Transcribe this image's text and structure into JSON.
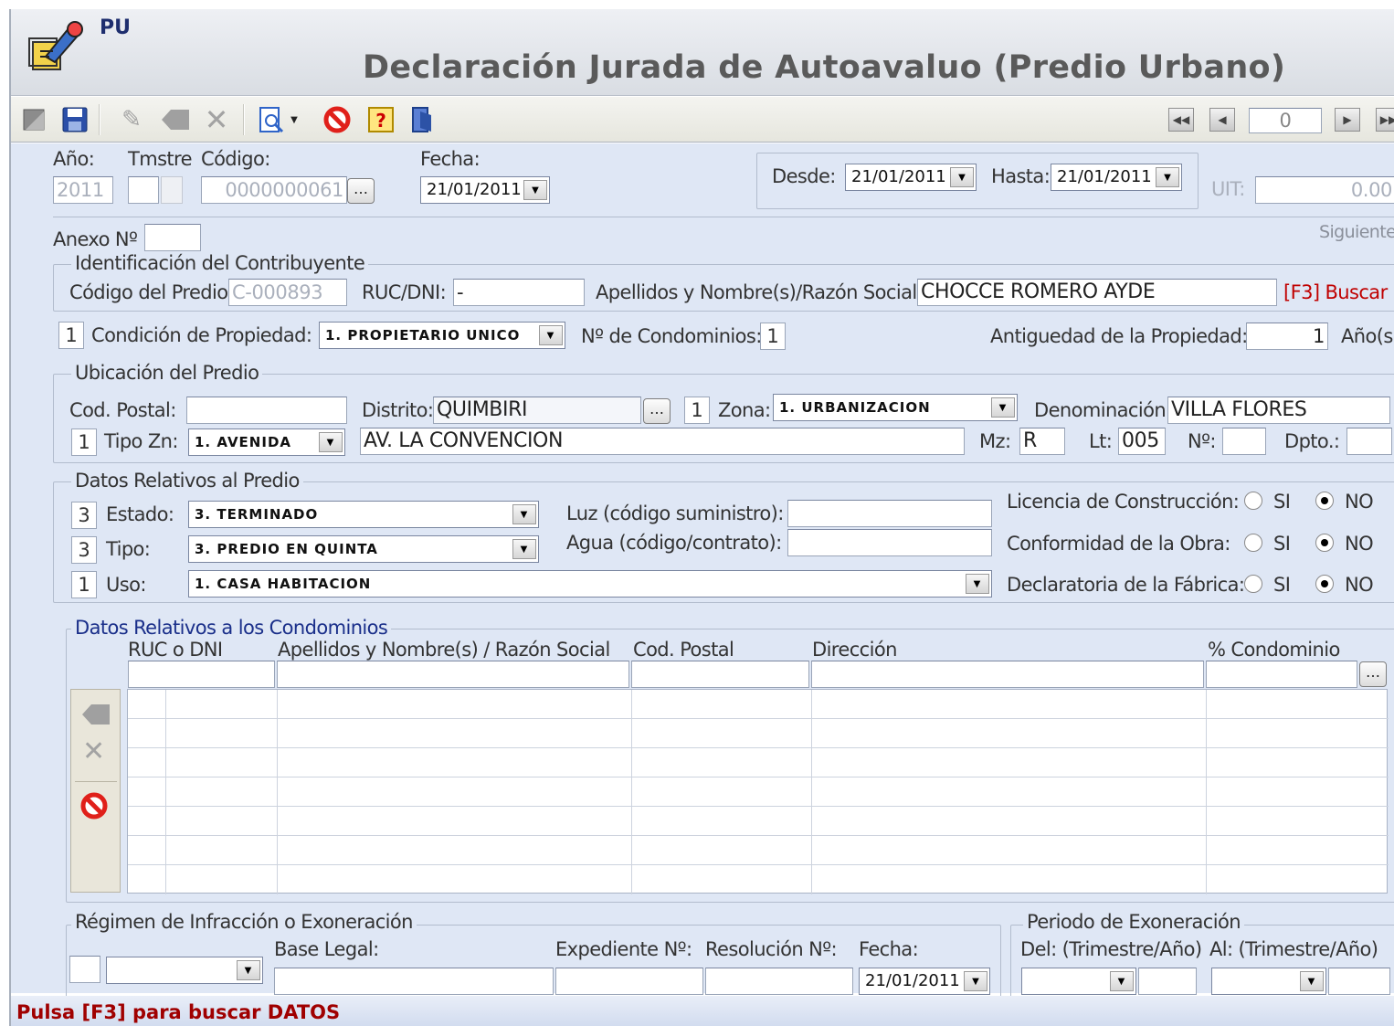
{
  "app": {
    "badge": "PU",
    "title": "Declaración Jurada de Autoavaluo (Predio Urbano)"
  },
  "toolbar": {
    "record_counter": "0"
  },
  "header": {
    "anio_label": "Año:",
    "anio_value": "2011",
    "tmstre_label": "Tmstre",
    "codigo_label": "Código:",
    "codigo_value": "0000000061",
    "fecha_label": "Fecha:",
    "fecha_value": "21/01/2011",
    "desde_label": "Desde:",
    "desde_value": "21/01/2011",
    "hasta_label": "Hasta:",
    "hasta_value": "21/01/2011",
    "uit_label": "UIT:",
    "uit_value": "0.00",
    "anexo_label": "Anexo Nº",
    "siguiente": "Siguiente"
  },
  "contribuyente": {
    "title": "Identificación del Contribuyente",
    "codigo_predio_label": "Código del Predio:",
    "codigo_predio_value": "C-000893",
    "ruc_label": "RUC/DNI:",
    "ruc_value": "-",
    "nombre_label": "Apellidos y Nombre(s)/Razón Social:",
    "nombre_value": "CHOCCE ROMERO AYDE",
    "buscar": "[F3] Buscar"
  },
  "propiedad": {
    "cond_num": "1",
    "cond_label": "Condición de Propiedad:",
    "cond_value": "1. PROPIETARIO UNICO",
    "condominios_label": "Nº de Condominios:",
    "condominios_value": "1",
    "antiguedad_label": "Antiguedad de la Propiedad:",
    "antiguedad_value": "1",
    "antiguedad_unit": "Año(s)"
  },
  "ubicacion": {
    "title": "Ubicación del Predio",
    "cod_postal_label": "Cod. Postal:",
    "distrito_label": "Distrito:",
    "distrito_value": "QUIMBIRI",
    "zona_num": "1",
    "zona_label": "Zona:",
    "zona_value": "1. URBANIZACION",
    "denominacion_label": "Denominación:",
    "denominacion_value": "VILLA FLORES",
    "tipozn_num": "1",
    "tipozn_label": "Tipo Zn:",
    "tipozn_value": "1. AVENIDA",
    "via_value": "AV. LA CONVENCION",
    "mz_label": "Mz:",
    "mz_value": "R",
    "lt_label": "Lt:",
    "lt_value": "005",
    "n_label": "Nº:",
    "dpto_label": "Dpto.:"
  },
  "predio": {
    "title": "Datos Relativos al Predio",
    "estado_num": "3",
    "estado_label": "Estado:",
    "estado_value": "3. TERMINADO",
    "tipo_num": "3",
    "tipo_label": "Tipo:",
    "tipo_value": "3. PREDIO EN QUINTA",
    "uso_num": "1",
    "uso_label": "Uso:",
    "uso_value": "1. CASA HABITACION",
    "luz_label": "Luz (código suministro):",
    "agua_label": "Agua (código/contrato):",
    "licencia_label": "Licencia de Construcción:",
    "conformidad_label": "Conformidad de la Obra:",
    "declaratoria_label": "Declaratoria de la Fábrica:",
    "si": "SI",
    "no": "NO"
  },
  "condominios": {
    "title": "Datos Relativos a los Condominios",
    "columns": [
      "RUC o DNI",
      "Apellidos y Nombre(s) / Razón Social",
      "Cod. Postal",
      "Dirección",
      "% Condominio"
    ]
  },
  "regimen": {
    "title": "Régimen de Infracción o Exoneración",
    "base_label": "Base Legal:",
    "exp_label": "Expediente Nº:",
    "res_label": "Resolución Nº:",
    "fecha_label": "Fecha:",
    "fecha_value": "21/01/2011"
  },
  "periodo": {
    "title": "Periodo de Exoneración",
    "del_label": "Del: (Trimestre/Año)",
    "al_label": "Al: (Trimestre/Año)"
  },
  "status": "Pulsa [F3] para buscar DATOS",
  "colors": {
    "form_bg": "#dfe7f5",
    "status_text": "#a00000",
    "link_red": "#c00000",
    "group_blue_title": "#1a2f8a"
  }
}
